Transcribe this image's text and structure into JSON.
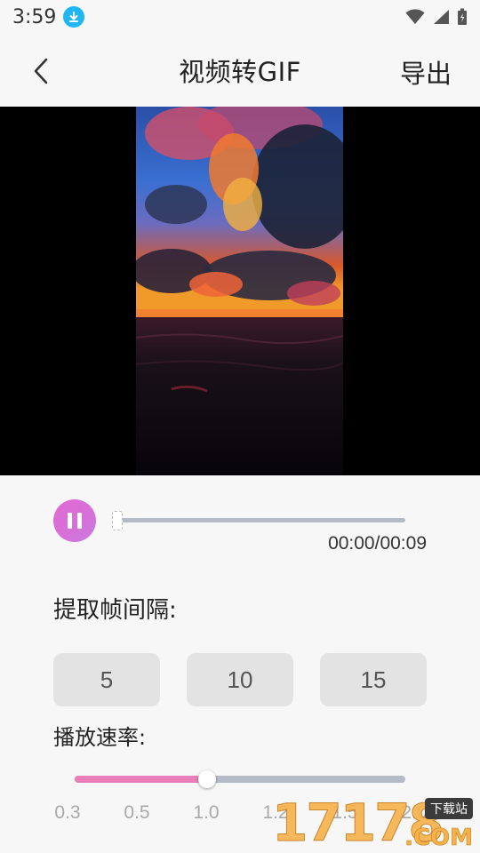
{
  "status_bar": {
    "time": "3:59",
    "icons": [
      "download-icon",
      "wifi-icon",
      "signal-icon",
      "battery-icon"
    ]
  },
  "header": {
    "title": "视频转GIF",
    "export_label": "导出",
    "back_icon": "chevron-left-icon"
  },
  "player": {
    "state_icon": "pause-icon",
    "progress": 0.0,
    "time_text": "00:00/00:09"
  },
  "interval": {
    "label": "提取帧间隔:",
    "options": [
      "5",
      "10",
      "15"
    ]
  },
  "speed": {
    "label": "播放速率:",
    "ticks": [
      "0.3",
      "0.5",
      "1.0",
      "1.2",
      "1.5",
      "2.0"
    ],
    "selected_value": "1.0"
  },
  "watermark": {
    "digits": "17178",
    "tag": "下载站",
    "suffix": ".COM"
  },
  "colors": {
    "accent_pink": "#e97fb9",
    "track_gray": "#b4bac6",
    "download_badge": "#1fb6f2"
  }
}
